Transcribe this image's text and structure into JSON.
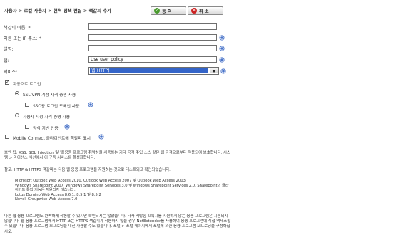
{
  "header": {
    "breadcrumb": "사용자 > 로컬 사용자 > 현역 정책 편집 > 책갈피 추가",
    "ok_label": "동 의",
    "cancel_label": "취 소"
  },
  "form": {
    "name_label": "책갈피 이름: *",
    "name_value": "",
    "host_label": "이름 또는 IP 주소: *",
    "host_value": "",
    "desc_label": "설명:",
    "desc_value": "",
    "tab_label": "탭:",
    "tab_value": "Use user policy",
    "service_label": "서비스:",
    "service_value": "웹(HTTP)"
  },
  "options": {
    "auto_login": "자동으로 로그인",
    "ssl_vpn_cred": "SSL VPN 계정 자격 증명 사용",
    "sso_domain": "SSO용 로그인 도메인 사용",
    "custom_cred": "사용자 지정 자격 증명 사용",
    "form_login": "양식 기반 인증",
    "mobile_connect": "Mobile Connect 클라이언트에 책갈피 표시"
  },
  "info": {
    "p1": "보안 팁: XSS, SQL Injection 및 웹 응용 프로그램 취약성을 사용하는 기타 공격 주입 소스 같은 웹 공격으로부터 적용되어 보호합니다. 시스템 > 라이선스 섹션에서 이 구독 서비스를 활성화합니다.",
    "p2": "참고: HTTP & HTTPS 책갈피는 다음 웹 응용 프로그램을 지원하는 것으로 테스트되고 확인되었습니다.",
    "bullets": [
      "Microsoft Outlook Web Access 2010, Outlook Web Access 2007 및 Outlook Web Access 2003.",
      "Windows Sharepoint 2007, Windows Sharepoint Services 3.0 및 Windows Sharepoint Services 2.0. Sharepoint의 클라이언트 통합 기능은 지원되지 않습니다.",
      "Lotus Domino Web Access 8.6.1, 8.5.1 및 8.5.2",
      "Novell Groupwise Web Access 7.0"
    ],
    "p3": "다른 웹 응용 프로그램도 완벽하게 작동할 수 있지만 확인되지는 않았습니다. 타사 역방향 프록시를 지원하지 않는 응용 프로그램은 지원되지 않습니다. 웹 응용 프로그램에서 HTTP 또는 HTTPS 책갈피가 작동하지 않을 경우 NetExtender를 사용하여 응용 프로그램에 직접 액세스할 수 있습니다. 응용 프로그램 오프로딩을 대신 사용할 수도 있습니다. 포털 > 포털 페이지에서 포털에 의한 응용 프로그램 오프로딩을 구성하십시오."
  },
  "colors": {
    "ok_icon": "#4a9b2e",
    "cancel_icon": "#cc2222",
    "help_icon": "#4a74c9",
    "select_highlight": "#3464c8"
  }
}
